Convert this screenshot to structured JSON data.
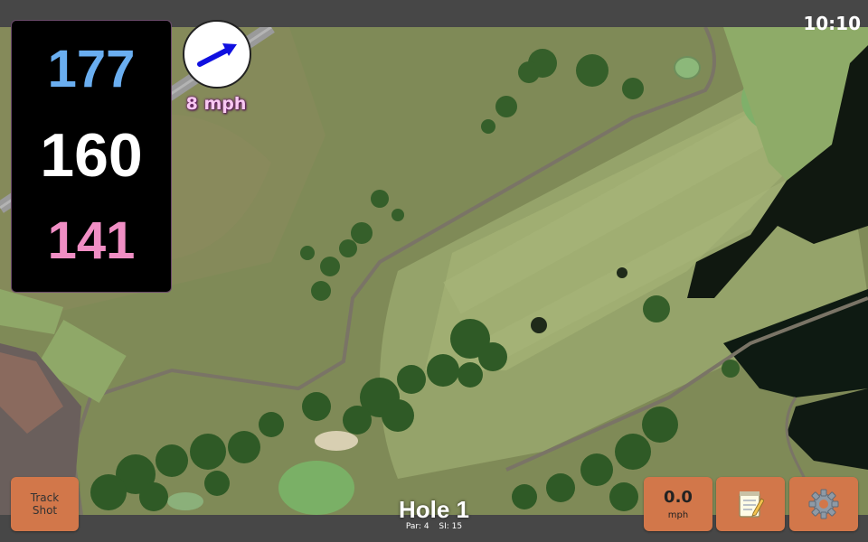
{
  "status_bar": {
    "time": "10:10"
  },
  "yardage": {
    "back": "177",
    "middle": "160",
    "front": "141",
    "colors": {
      "back": "#6aaef0",
      "middle": "#ffffff",
      "front": "#f08ec4"
    }
  },
  "wind": {
    "speed": "8 mph",
    "icon": "wind-arrow-icon"
  },
  "hole": {
    "title": "Hole 1",
    "par": "Par: 4",
    "stroke_index": "SI: 15"
  },
  "buttons": {
    "track_shot": "Track\nShot",
    "speed_value": "0.0",
    "speed_unit": "mph",
    "notes_icon": "notepad-icon",
    "settings_icon": "gear-icon"
  },
  "colors": {
    "button": "#d2774a",
    "bar": "#474747"
  }
}
